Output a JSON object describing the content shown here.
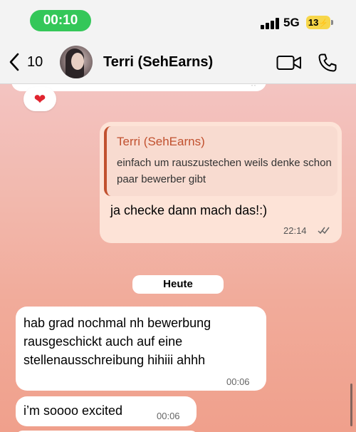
{
  "status_bar": {
    "time": "00:10",
    "network": "5G",
    "battery": "13"
  },
  "header": {
    "back_count": "10",
    "contact_name": "Terri (SehEarns)"
  },
  "chat": {
    "reaction_emoji": "❤",
    "outgoing": {
      "quote_author": "Terri (SehEarns)",
      "quote_text": "einfach um rauszustechen weils denke schon paar bewerber gibt",
      "text": "ja checke dann mach das!:)",
      "time": "22:14"
    },
    "date_separator": "Heute",
    "incoming": [
      {
        "text": "hab grad nochmal nh bewerbung rausgeschickt auch auf eine stellenausschreibung hihiii ahhh",
        "time": "00:06"
      },
      {
        "text": "i’m soooo excited",
        "time": "00:06"
      }
    ]
  },
  "colors": {
    "status_green": "#34c759",
    "battery_yellow": "#f7d64a",
    "quote_accent": "#c1512f",
    "outgoing_bubble": "#fde3d7"
  }
}
